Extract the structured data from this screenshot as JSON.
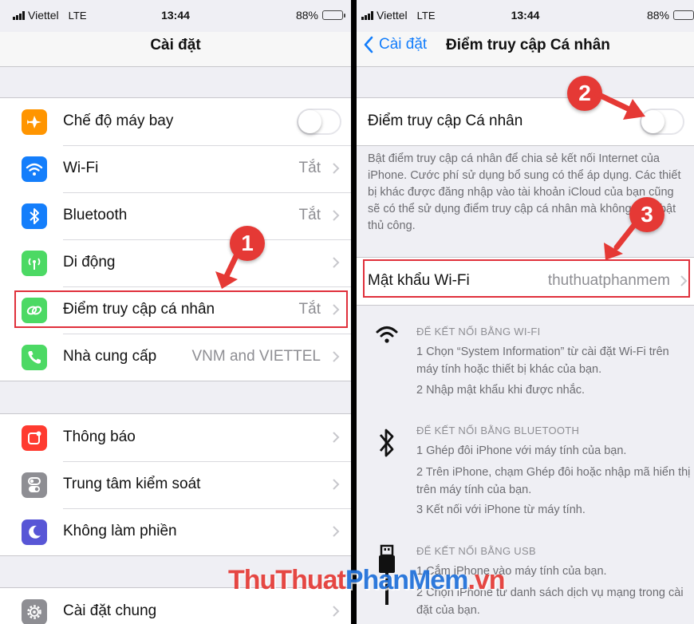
{
  "status_left": {
    "carrier": "Viettel",
    "network": "LTE",
    "time": "13:44",
    "battery": "88%"
  },
  "status_right": {
    "carrier": "Viettel",
    "network": "LTE",
    "time": "13:44",
    "battery": "88%"
  },
  "battery_level": 0.88,
  "left": {
    "title": "Cài đặt",
    "group1": [
      {
        "label": "Chế độ máy bay",
        "value": "",
        "icon": "airplane-icon",
        "color": "#ff9500",
        "toggle": false
      },
      {
        "label": "Wi-Fi",
        "value": "Tắt",
        "icon": "wifi-icon",
        "color": "#147efb"
      },
      {
        "label": "Bluetooth",
        "value": "Tắt",
        "icon": "bluetooth-icon",
        "color": "#147efb"
      },
      {
        "label": "Di động",
        "value": "",
        "icon": "cellular-icon",
        "color": "#4cd964"
      },
      {
        "label": "Điểm truy cập cá nhân",
        "value": "Tắt",
        "icon": "hotspot-icon",
        "color": "#4cd964"
      },
      {
        "label": "Nhà cung cấp",
        "value": "VNM and VIETTEL",
        "icon": "phone-icon",
        "color": "#4cd964"
      }
    ],
    "group2": [
      {
        "label": "Thông báo",
        "icon": "notifications-icon",
        "color": "#ff3b30"
      },
      {
        "label": "Trung tâm kiểm soát",
        "icon": "control-center-icon",
        "color": "#8e8e93"
      },
      {
        "label": "Không làm phiền",
        "icon": "moon-icon",
        "color": "#5856d6"
      }
    ],
    "group3": [
      {
        "label": "Cài đặt chung",
        "icon": "gear-icon",
        "color": "#8e8e93"
      }
    ]
  },
  "right": {
    "back_label": "Cài đặt",
    "title": "Điểm truy cập Cá nhân",
    "hotspot_label": "Điểm truy cập Cá nhân",
    "hotspot_on": false,
    "description": "Bật điểm truy cập cá nhân để chia sẻ kết nối Internet của iPhone. Cước phí sử dụng bổ sung có thể áp dụng. Các thiết bị khác được đăng nhập vào tài khoản iCloud của bạn cũng sẽ có thể sử dụng điểm truy cập cá nhân mà không phải bật thủ công.",
    "password_label": "Mật khẩu Wi-Fi",
    "password_value": "thuthuatphanmem",
    "wifi_section": {
      "title": "ĐỂ KẾT NỐI BẰNG WI-FI",
      "steps": [
        "1 Chọn “System Information” từ cài đặt Wi-Fi trên máy tính hoặc thiết bị khác của bạn.",
        "2 Nhập mật khẩu khi được nhắc."
      ]
    },
    "bt_section": {
      "title": "ĐỂ KẾT NỐI BẰNG BLUETOOTH",
      "steps": [
        "1 Ghép đôi iPhone với máy tính của bạn.",
        "2 Trên iPhone, chạm Ghép đôi hoặc nhập mã hiển thị trên máy tính của bạn.",
        "3 Kết nối với iPhone từ máy tính."
      ]
    },
    "usb_section": {
      "title": "ĐỂ KẾT NỐI BẰNG USB",
      "steps": [
        "1 Cắm iPhone vào máy tính của bạn.",
        "2 Chọn iPhone từ danh sách dịch vụ mạng trong cài đặt của bạn."
      ]
    }
  },
  "badges": [
    "1",
    "2",
    "3"
  ],
  "watermark": {
    "part1": "ThuThuat",
    "part2": "PhanMem",
    "part3": ".vn"
  },
  "colors": {
    "accent": "#147efb",
    "highlight": "#e0303b"
  }
}
